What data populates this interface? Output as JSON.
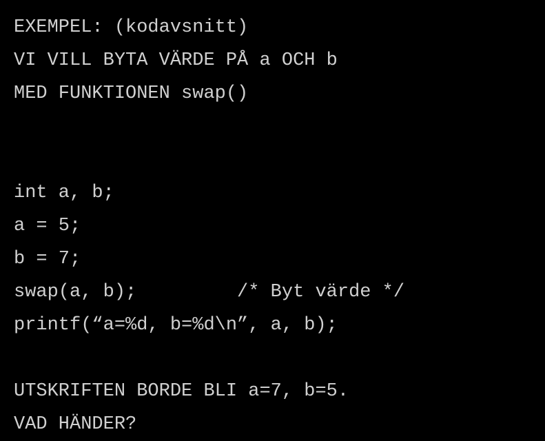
{
  "lines": {
    "l1": "EXEMPEL: (kodavsnitt)",
    "l2": "VI VILL BYTA VÄRDE PÅ a OCH b",
    "l3": "MED FUNKTIONEN swap()",
    "l4": "int a, b;",
    "l5": "a = 5;",
    "l6": "b = 7;",
    "l7": "swap(a, b);         /* Byt värde */",
    "l8": "printf(“a=%d, b=%d\\n”, a, b);",
    "l9": "UTSKRIFTEN BORDE BLI a=7, b=5.",
    "l10": "VAD HÄNDER?"
  }
}
